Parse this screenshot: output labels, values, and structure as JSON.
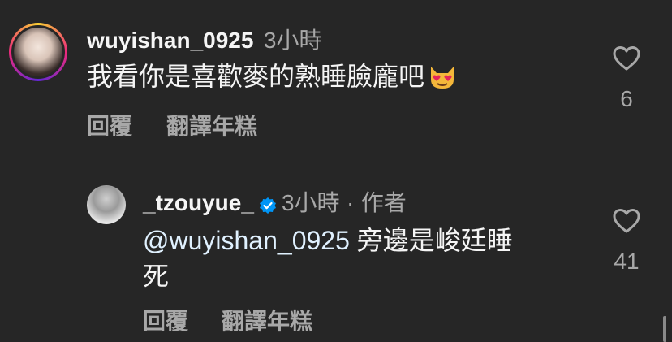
{
  "comments": [
    {
      "username": "wuyishan_0925",
      "time": "3小時",
      "text": "我看你是喜歡麥的熟睡臉龐吧",
      "emoji": "heart-eyes-cat",
      "likes": "6",
      "reply_label": "回覆",
      "translate_label": "翻譯年糕"
    },
    {
      "username": "_tzouyue_",
      "verified": true,
      "time": "3小時",
      "separator": "·",
      "author_label": "作者",
      "mention": "@wuyishan_0925",
      "text_line1": "旁邊是峻廷睡",
      "text_line2": "死",
      "likes": "41",
      "reply_label": "回覆",
      "translate_label": "翻譯年糕"
    }
  ],
  "colors": {
    "background": "#262626",
    "text_primary": "#f5f5f5",
    "text_secondary": "#a8a8a8",
    "mention": "#e0f1ff",
    "verified": "#0095f6"
  }
}
